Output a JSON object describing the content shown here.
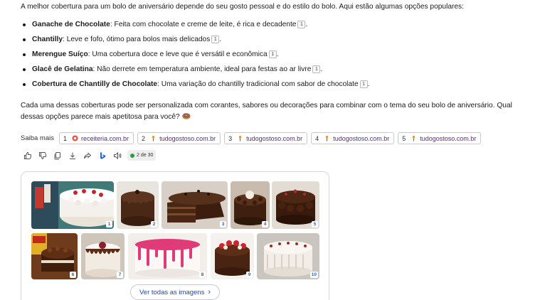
{
  "intro": "A melhor cobertura para um bolo de aniversário depende do seu gosto pessoal e do estilo do bolo. Aqui estão algumas opções populares:",
  "bullets": [
    {
      "title": "Ganache de Chocolate",
      "text": ": Feita com chocolate e creme de leite, é rica e decadente",
      "cite": "1",
      "end": "."
    },
    {
      "title": "Chantilly",
      "text": ": Leve e fofo, ótimo para bolos mais delicados",
      "cite": "1",
      "end": "."
    },
    {
      "title": "Merengue Suíço",
      "text": ": Uma cobertura doce e leve que é versátil e econômica",
      "cite": "1",
      "end": "."
    },
    {
      "title": "Glacê de Gelatina",
      "text": ": Não derrete em temperatura ambiente, ideal para festas ao ar livre",
      "cite": "1",
      "end": "."
    },
    {
      "title": "Cobertura de Chantilly de Chocolate",
      "text": ": Uma variação do chantilly tradicional com sabor de chocolate",
      "cite": "1",
      "end": "."
    }
  ],
  "outro": "Cada uma dessas coberturas pode ser personalizada com corantes, sabores ou decorações para combinar com o tema do seu bolo de aniversário. Qual dessas opções parece mais apetitosa para você? 🍩",
  "learn_more": {
    "label": "Saiba mais",
    "sources": [
      {
        "num": "1",
        "domain": "receiteria.com.br",
        "icon": "receiteria-favicon"
      },
      {
        "num": "2",
        "domain": "tudogostoso.com.br",
        "icon": "tudogostoso-favicon"
      },
      {
        "num": "3",
        "domain": "tudogostoso.com.br",
        "icon": "tudogostoso-favicon"
      },
      {
        "num": "4",
        "domain": "tudogostoso.com.br",
        "icon": "tudogostoso-favicon"
      },
      {
        "num": "5",
        "domain": "tudogostoso.com.br",
        "icon": "tudogostoso-favicon"
      }
    ]
  },
  "actions": {
    "icons": [
      "thumbs-up-icon",
      "thumbs-down-icon",
      "copy-icon",
      "download-icon",
      "share-icon",
      "bing-icon",
      "speaker-icon"
    ],
    "counter": "2 de 30",
    "counter_color": "#2e9a49"
  },
  "gallery": {
    "images": [
      {
        "label": "1",
        "theme": "white-cream-cake"
      },
      {
        "label": "2",
        "theme": "chocolate-ganache-cake"
      },
      {
        "label": "3",
        "theme": "chocolate-slice-cake"
      },
      {
        "label": "4",
        "theme": "chocolate-truffle-cake"
      },
      {
        "label": "5",
        "theme": "chocolate-rosettes-cake"
      },
      {
        "label": "6",
        "theme": "chocolate-layer-cake"
      },
      {
        "label": "7",
        "theme": "white-drip-cake"
      },
      {
        "label": "8",
        "theme": "pink-drip-cake"
      },
      {
        "label": "9",
        "theme": "strawberry-chocolate-cake"
      },
      {
        "label": "10",
        "theme": "white-piped-cake"
      }
    ],
    "view_all": "Ver todas as imagens"
  },
  "colors": {
    "link": "#1d48b6",
    "source_text": "#5b2a86"
  }
}
